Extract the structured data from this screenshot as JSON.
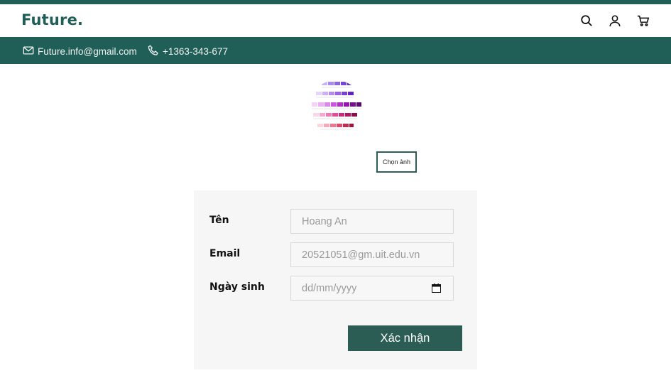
{
  "brand": {
    "logo_text": "Future."
  },
  "header": {
    "icons": [
      "search-icon",
      "user-icon",
      "cart-icon"
    ]
  },
  "contact": {
    "email": "Future.info@gmail.com",
    "phone": "+1363-343-677",
    "email_icon": "mail-icon",
    "phone_icon": "phone-icon"
  },
  "avatar": {
    "icon": "avatar-image"
  },
  "upload": {
    "choose_label": "Chọn ảnh"
  },
  "form": {
    "name_label": "Tên",
    "name_placeholder": "Hoang An",
    "email_label": "Email",
    "email_placeholder": "20521051@gm.uit.edu.vn",
    "dob_label": "Ngày sinh",
    "dob_placeholder": "dd/mm/yyyy",
    "submit_label": "Xác nhận"
  },
  "colors": {
    "brand": "#1f5f58",
    "button": "#2b5d55",
    "panel": "#f6f6f6"
  }
}
